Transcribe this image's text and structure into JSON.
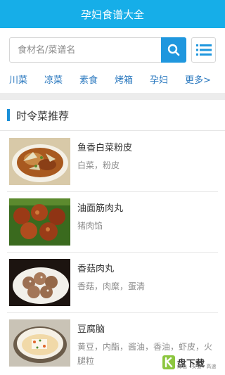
{
  "header": {
    "title": "孕妇食谱大全"
  },
  "search": {
    "placeholder": "食材名/菜谱名",
    "button": "search-icon",
    "menu": "list-icon"
  },
  "categories": [
    "川菜",
    "凉菜",
    "素食",
    "烤箱",
    "孕妇",
    "更多>"
  ],
  "section": {
    "title": "时令菜推荐"
  },
  "recipes": [
    {
      "title": "鱼香白菜粉皮",
      "ingredients": "白菜，粉皮"
    },
    {
      "title": "油面筋肉丸",
      "ingredients": "猪肉馅"
    },
    {
      "title": "香菇肉丸",
      "ingredients": "香菇，肉糜，蛋清"
    },
    {
      "title": "豆腐脑",
      "ingredients": "黄豆，内酯，酱油，香油，虾皮，火腿粒"
    }
  ],
  "watermark": {
    "brand": "盘下载",
    "tagline": "绿色 · 安全 · 高速"
  },
  "colors": {
    "appbar": "#16aee8",
    "search_button": "#1f97de",
    "category_text": "#2a78bf",
    "section_accent": "#1a8fd8"
  }
}
